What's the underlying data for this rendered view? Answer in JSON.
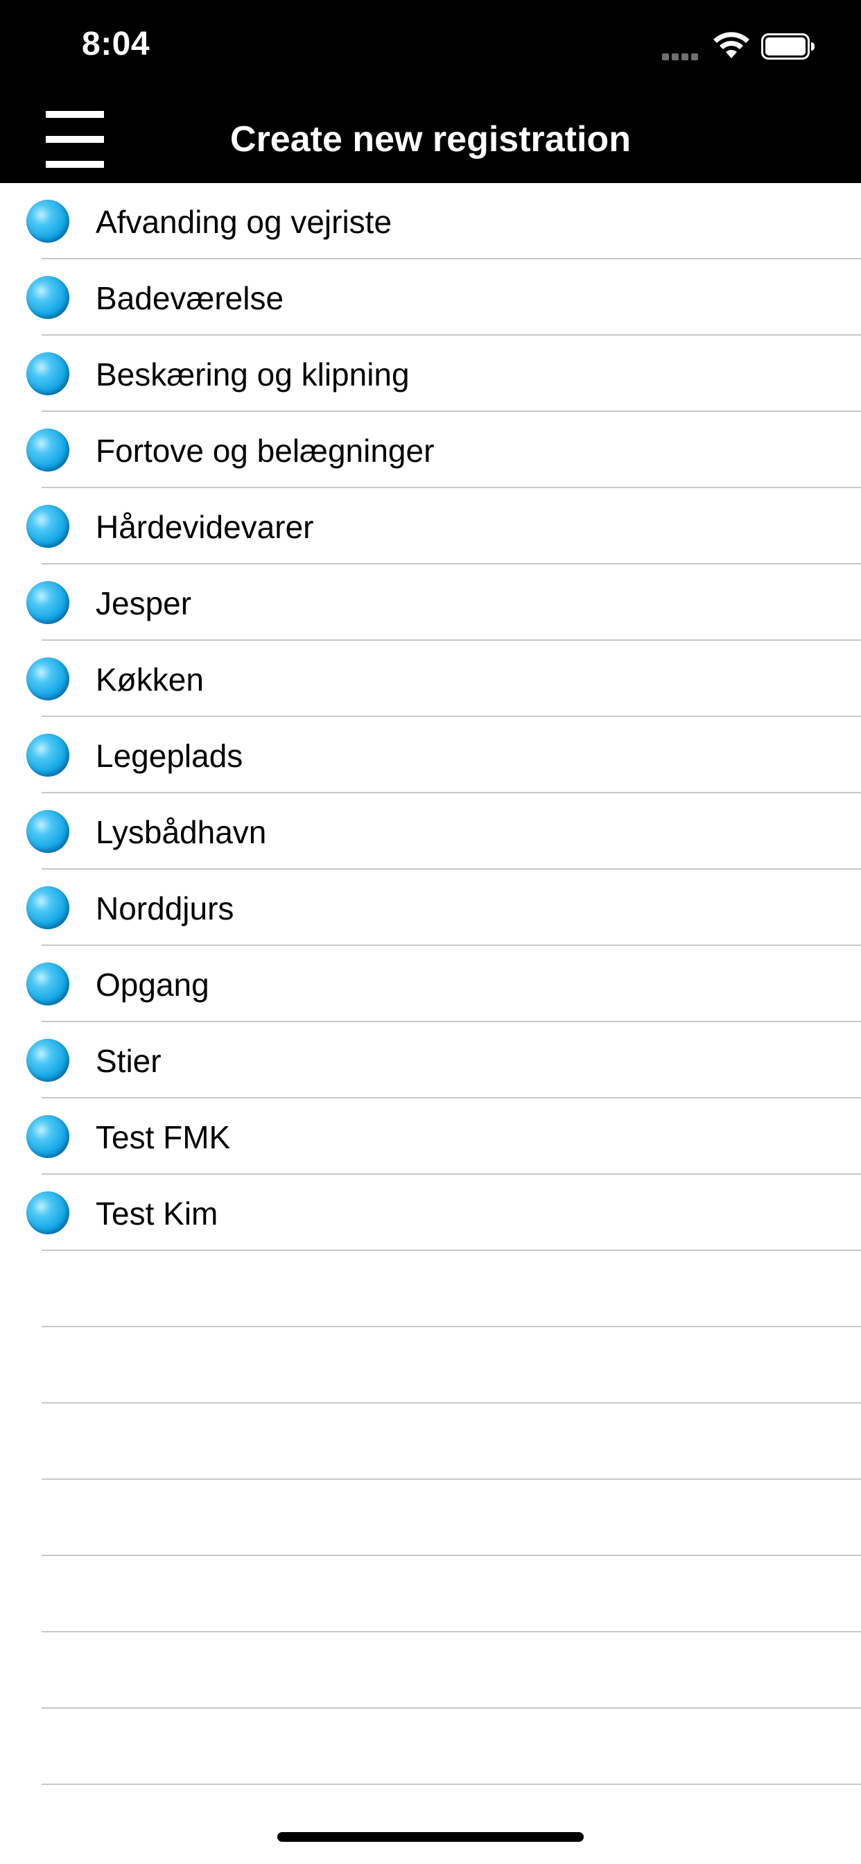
{
  "status_bar": {
    "time": "8:04"
  },
  "nav": {
    "title": "Create new registration",
    "menu_icon": "hamburger-icon"
  },
  "items": [
    "Afvanding og vejriste",
    "Badeværelse",
    "Beskæring og klipning",
    "Fortove og belægninger",
    "Hårdevidevarer",
    "Jesper",
    "Køkken",
    "Legeplads",
    "Lysbådhavn",
    "Norddjurs",
    "Opgang",
    "Stier",
    "Test FMK",
    "Test Kim"
  ],
  "colors": {
    "bar_background": "#000000",
    "bullet": "#1aa9e8",
    "separator": "#c8c8c8"
  }
}
